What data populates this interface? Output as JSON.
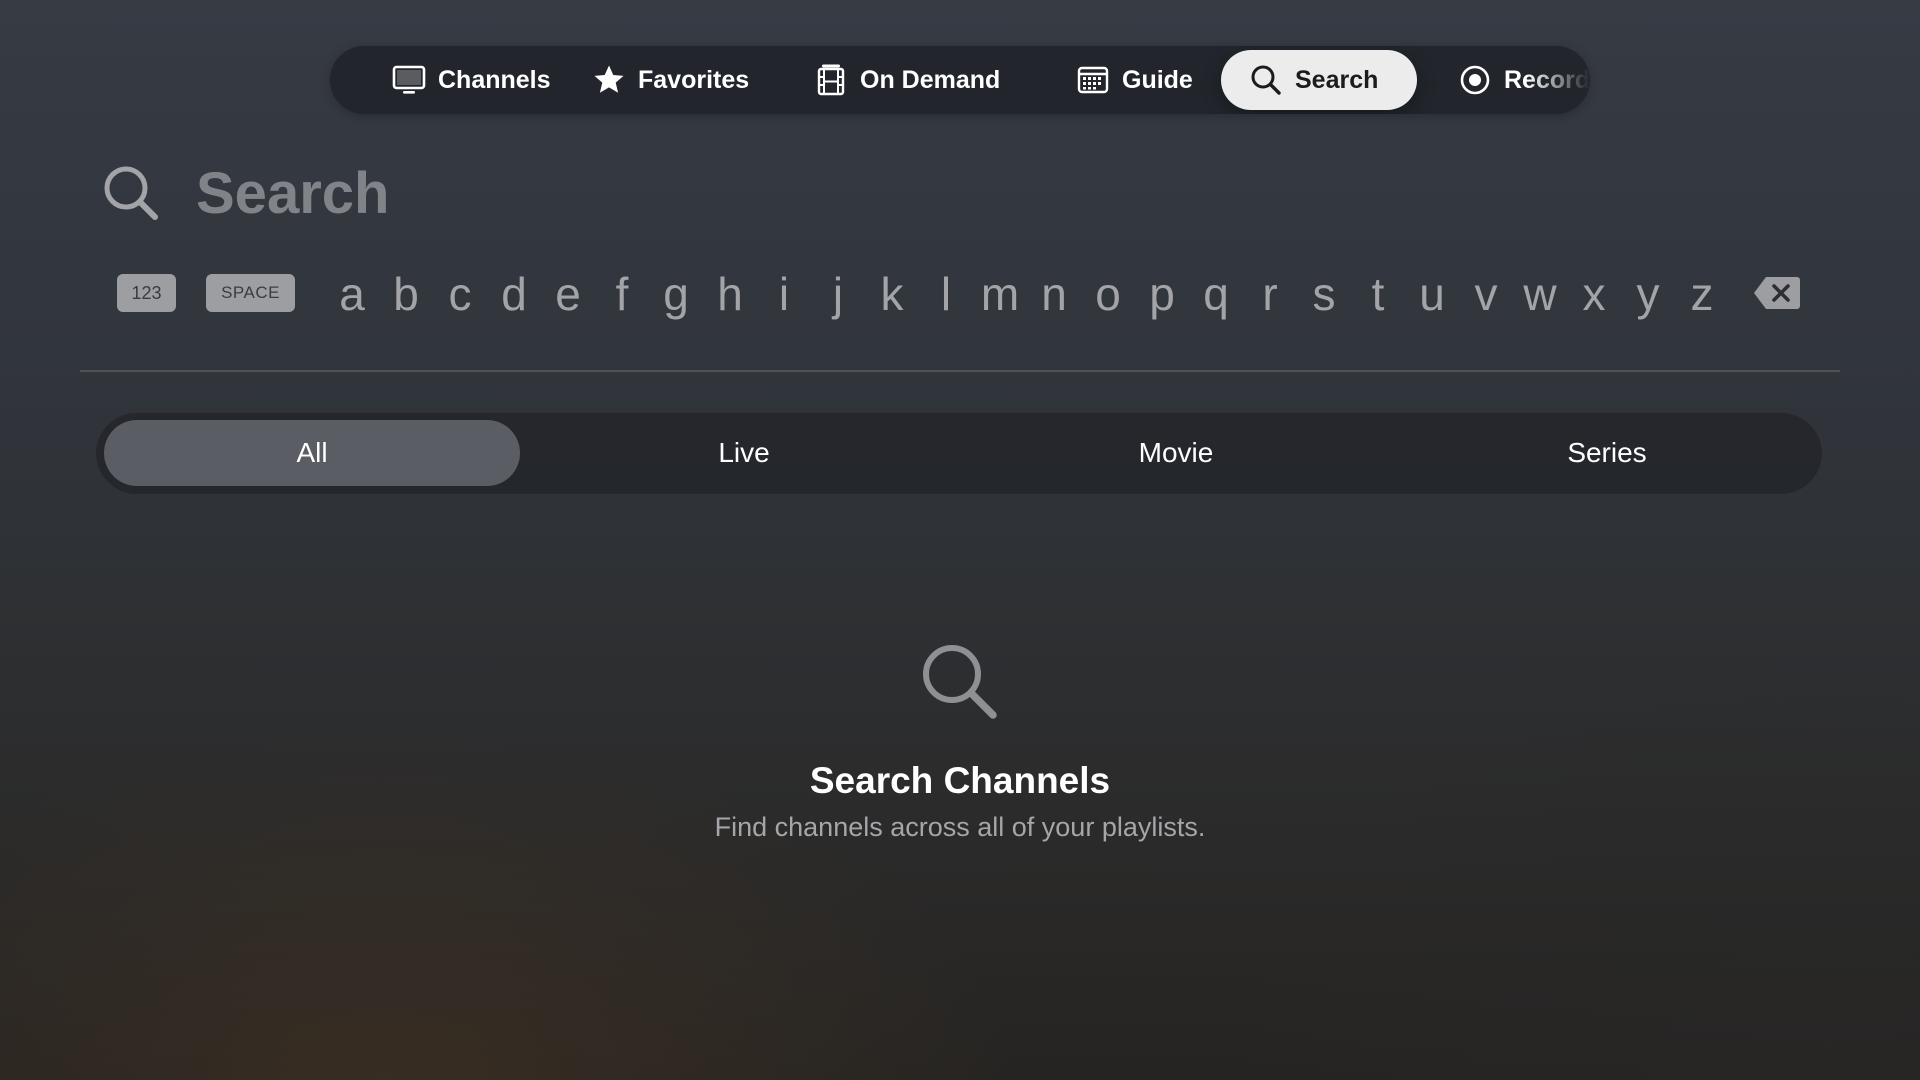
{
  "tabs": [
    {
      "label": "Channels",
      "icon": "tv-icon"
    },
    {
      "label": "Favorites",
      "icon": "star-icon"
    },
    {
      "label": "On Demand",
      "icon": "film-icon"
    },
    {
      "label": "Guide",
      "icon": "calendar-grid-icon"
    },
    {
      "label": "Search",
      "icon": "search-icon",
      "active": true
    },
    {
      "label": "Recordings",
      "icon": "record-icon"
    }
  ],
  "search": {
    "placeholder": "Search",
    "value": ""
  },
  "keyboard": {
    "numbers_key": "123",
    "space_key": "SPACE",
    "letters": [
      "a",
      "b",
      "c",
      "d",
      "e",
      "f",
      "g",
      "h",
      "i",
      "j",
      "k",
      "l",
      "m",
      "n",
      "o",
      "p",
      "q",
      "r",
      "s",
      "t",
      "u",
      "v",
      "w",
      "x",
      "y",
      "z"
    ],
    "delete_icon": "delete-backward-icon"
  },
  "filters": {
    "items": [
      "All",
      "Live",
      "Movie",
      "Series"
    ],
    "selected": "All"
  },
  "empty_state": {
    "icon": "search-icon",
    "title": "Search Channels",
    "subtitle": "Find channels across all of your playlists."
  },
  "colors": {
    "active_tab_bg": "#ececec",
    "active_segment_bg": "#5a5d63",
    "muted_text": "#a4a6aa"
  }
}
